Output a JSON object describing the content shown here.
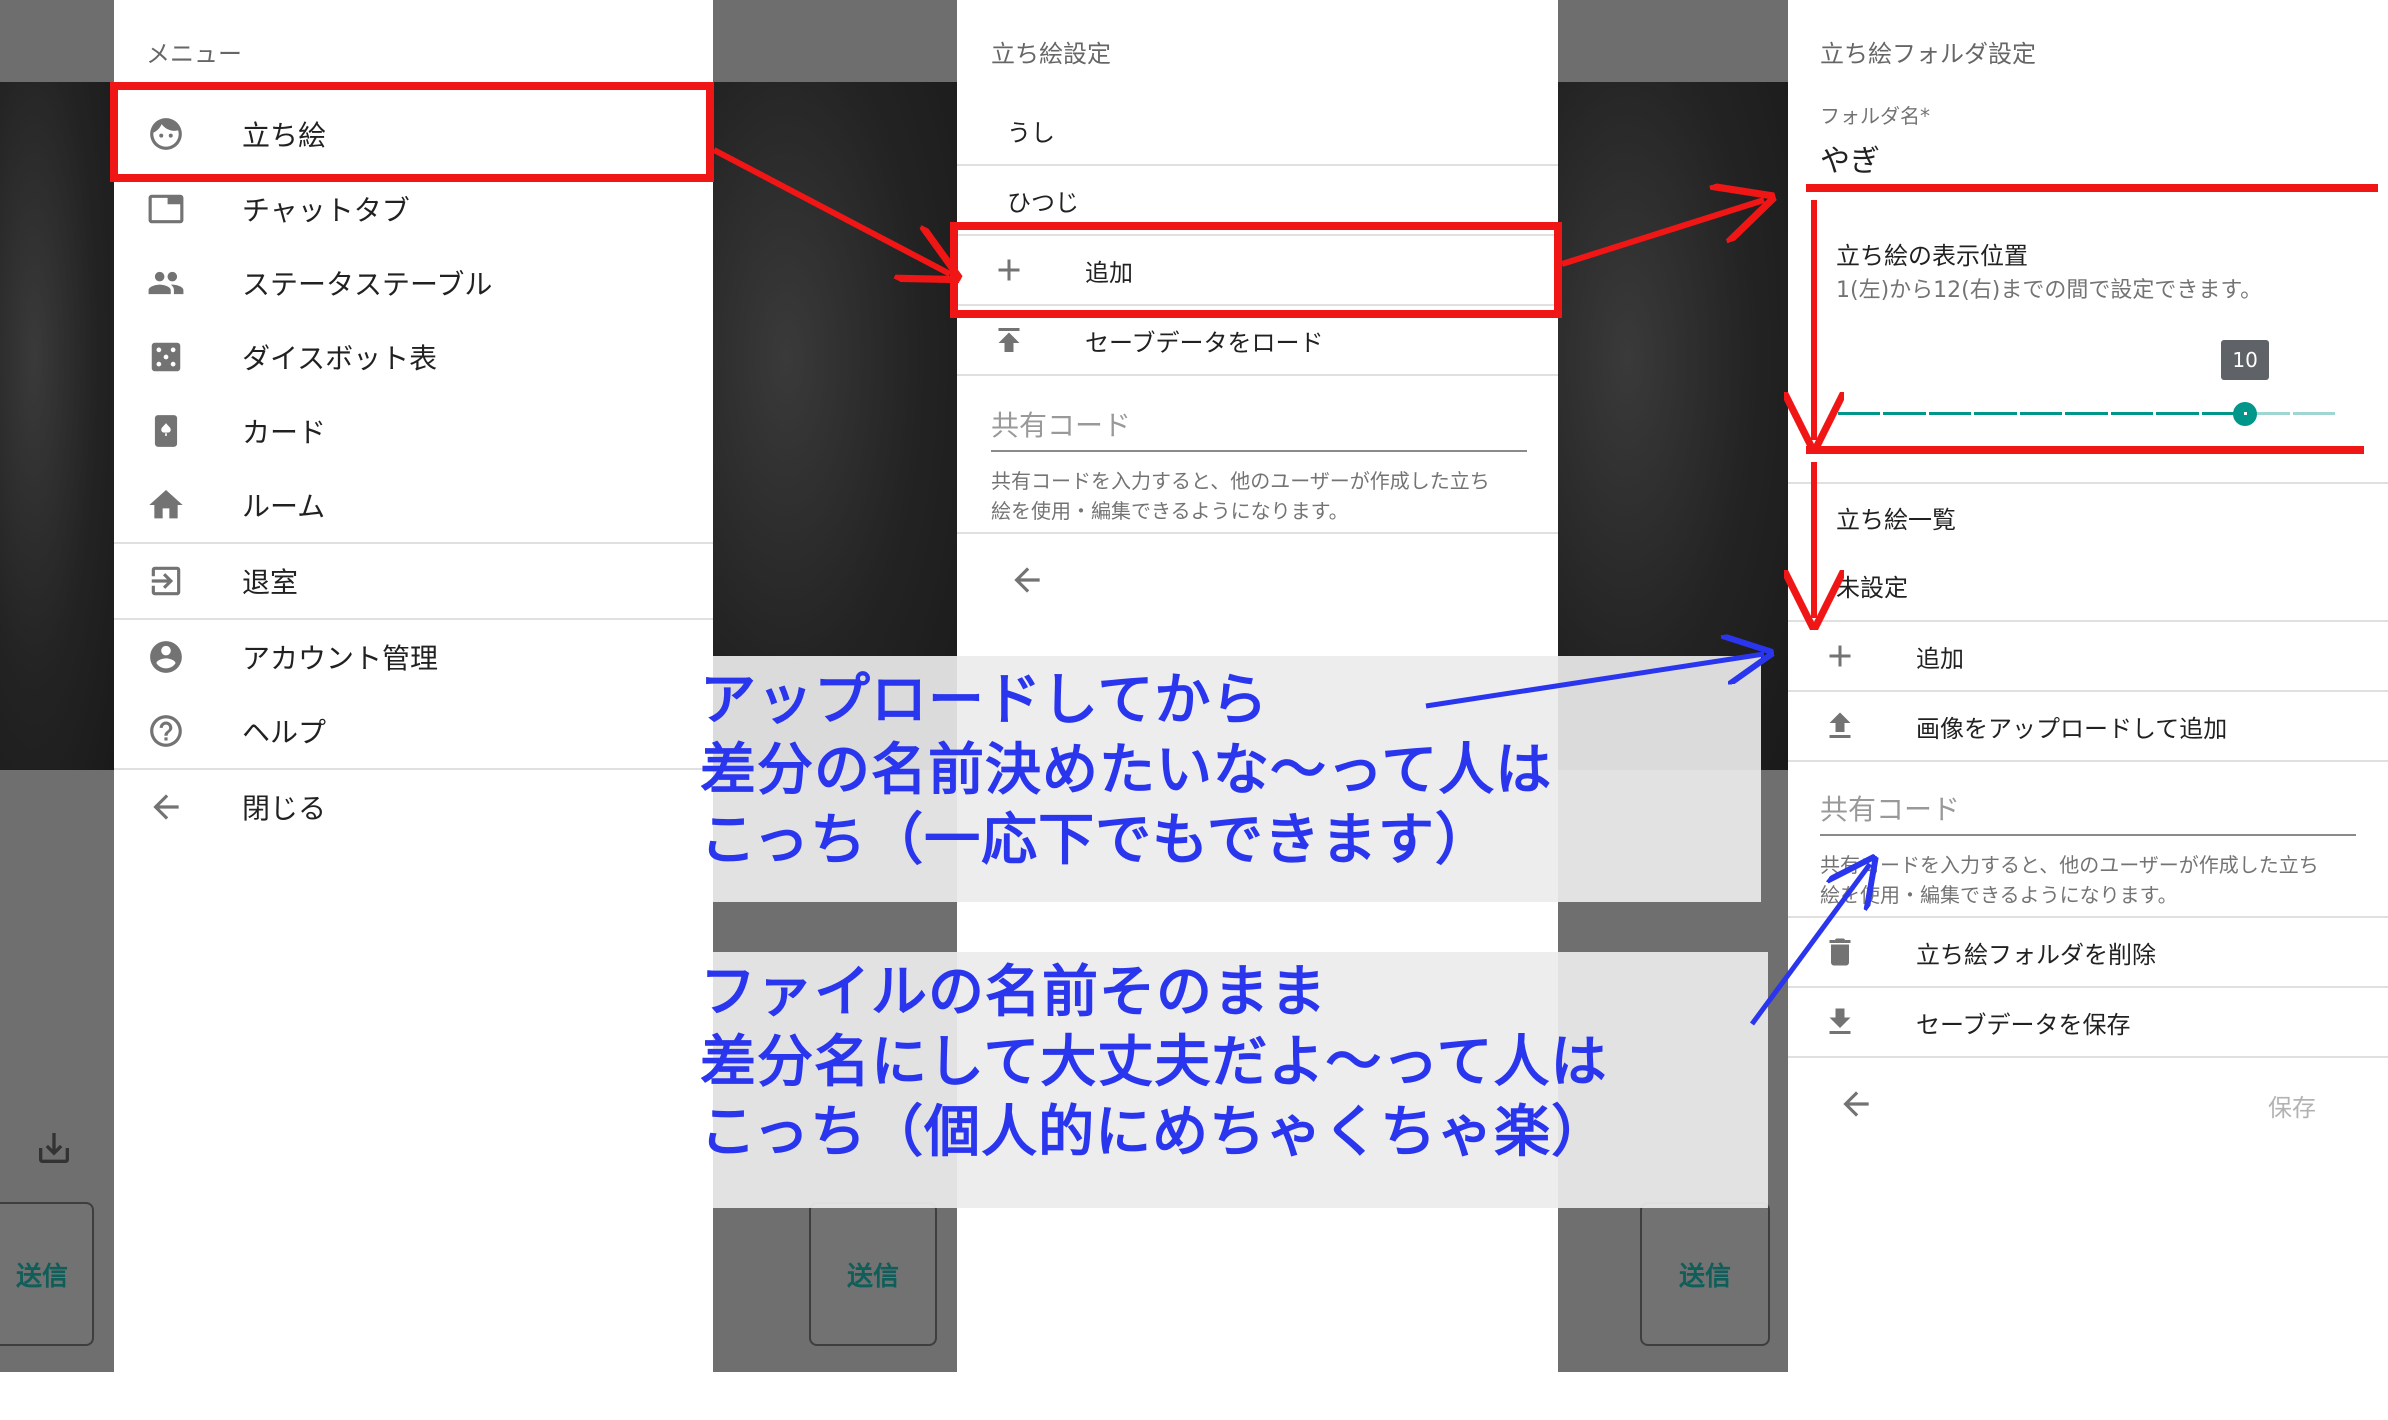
{
  "left_panel": {
    "header": "メニュー",
    "items": [
      {
        "label": "立ち絵",
        "icon": "face-icon"
      },
      {
        "label": "チャットタブ",
        "icon": "tab-icon"
      },
      {
        "label": "ステータステーブル",
        "icon": "people-icon"
      },
      {
        "label": "ダイスボット表",
        "icon": "dice-icon"
      },
      {
        "label": "カード",
        "icon": "card-icon"
      },
      {
        "label": "ルーム",
        "icon": "home-icon"
      },
      {
        "label": "退室",
        "icon": "exit-icon"
      },
      {
        "label": "アカウント管理",
        "icon": "account-icon"
      },
      {
        "label": "ヘルプ",
        "icon": "help-icon"
      },
      {
        "label": "閉じる",
        "icon": "arrow-left-icon"
      }
    ]
  },
  "middle_panel": {
    "header": "立ち絵設定",
    "folders": [
      "うし",
      "ひつじ"
    ],
    "add_label": "追加",
    "load_label": "セーブデータをロード",
    "share_code_placeholder": "共有コード",
    "share_code_help_1": "共有コードを入力すると、他のユーザーが作成した立ち",
    "share_code_help_2": "絵を使用・編集できるようになります。"
  },
  "right_panel": {
    "header": "立ち絵フォルダ設定",
    "folder_name_label": "フォルダ名*",
    "folder_name_value": "やぎ",
    "position_title": "立ち絵の表示位置",
    "position_help": "1(左)から12(右)までの間で設定できます。",
    "slider_value": "10",
    "slider_min": 1,
    "slider_max": 12,
    "list_title": "立ち絵一覧",
    "unset_label": "未設定",
    "add_label": "追加",
    "upload_label": "画像をアップロードして追加",
    "share_code_placeholder": "共有コード",
    "share_code_help_1": "共有コードを入力すると、他のユーザーが作成した立ち",
    "share_code_help_2": "絵を使用・編集できるようになります。",
    "delete_label": "立ち絵フォルダを削除",
    "save_data_label": "セーブデータを保存",
    "save_button": "保存"
  },
  "background": {
    "send_label": "送信"
  },
  "annotations": {
    "upper": [
      "アップロードしてから",
      "差分の名前決めたいな～って人は",
      "こっち（一応下でもできます）"
    ],
    "lower": [
      "ファイルの名前そのまま",
      "差分名にして大丈夫だよ～って人は",
      "こっち（個人的にめちゃくちゃ楽）"
    ]
  },
  "colors": {
    "highlight_red": "#f01616",
    "annotation_blue": "#2a35ee",
    "slider_teal": "#00968a"
  }
}
